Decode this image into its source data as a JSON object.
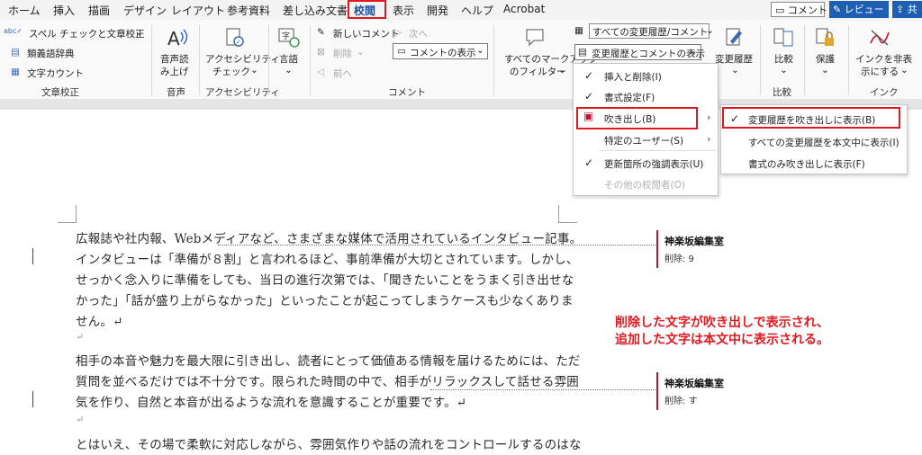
{
  "menu": {
    "tabs": [
      "ホーム",
      "挿入",
      "描画",
      "デザイン",
      "レイアウト",
      "参考資料",
      "差し込み文書",
      "校閲",
      "表示",
      "開発",
      "ヘルプ",
      "Acrobat"
    ],
    "active_tab": "校閲",
    "comment_button": "コメント",
    "review_button": "レビュー",
    "share_button": "共"
  },
  "ribbon": {
    "proofing": {
      "spell_check": "スペル チェックと文章校正",
      "thesaurus": "類義語辞典",
      "word_count": "文字カウント",
      "label": "文章校正"
    },
    "speech": {
      "read_aloud_line1": "音声読",
      "read_aloud_line2": "み上げ",
      "label": "音声"
    },
    "accessibility": {
      "check_line1": "アクセシビリティ",
      "check_line2": "チェック",
      "label": "アクセシビリティ"
    },
    "language": {
      "button": "言語"
    },
    "comments": {
      "new_comment": "新しいコメント",
      "delete": "削除",
      "prev": "前へ",
      "next": "次へ",
      "show_comments": "コメントの表示",
      "label": "コメント"
    },
    "tracking": {
      "all_markup_line1": "すべてのマークアップ",
      "all_markup_line2": "のフィルター",
      "all_changes": "すべての変更履歴/コメント",
      "show_markup": "変更履歴とコメントの表示"
    },
    "changes": {
      "track_changes": "変更履歴"
    },
    "compare": {
      "button": "比較",
      "label": "比較"
    },
    "protect": {
      "button": "保護"
    },
    "ink": {
      "hide_line1": "インクを非表",
      "hide_line2": "示にする",
      "label": "インク"
    }
  },
  "show_markup_menu": {
    "items": [
      {
        "label": "挿入と削除(I)",
        "checked": true
      },
      {
        "label": "書式設定(F)",
        "checked": true
      },
      {
        "label": "吹き出し(B)",
        "checked": false,
        "submenu": true
      },
      {
        "label": "特定のユーザー(S)",
        "checked": false,
        "submenu": true
      },
      {
        "label": "更新箇所の強調表示(U)",
        "checked": true
      },
      {
        "label": "その他の校閲者(O)",
        "checked": false,
        "disabled": true
      }
    ]
  },
  "balloons_submenu": {
    "items": [
      {
        "label": "変更履歴を吹き出しに表示(B)",
        "checked": true
      },
      {
        "label": "すべての変更履歴を本文中に表示(I)",
        "checked": false
      },
      {
        "label": "書式のみ吹き出しに表示(F)",
        "checked": false
      }
    ]
  },
  "document": {
    "lines": [
      "広報誌や社内報、Webメディアなど、さまざまな媒体で活用されているインタビュー記事。",
      "インタビューは「準備が８割」と言われるほど、事前準備が大切とされています。しかし、",
      "せっかく念入りに準備をしても、当日の進行次第では、「聞きたいことをうまく引き出せな",
      "かった」「話が盛り上がらなかった」といったことが起こってしまうケースも少なくありま",
      "せん。↵",
      "↵",
      "相手の本音や魅力を最大限に引き出し、読者にとって価値ある情報を届けるためには、ただ",
      "質問を並べるだけでは不十分です。限られた時間の中で、相手がリラックスして話せる雰囲",
      "気を作り、自然と本音が出るような流れを意識することが重要です。↵",
      "↵",
      "とはいえ、その場で柔軟に対応しながら、雰囲気作りや話の流れをコントロールするのはな"
    ]
  },
  "comments": [
    {
      "author": "神楽坂編集室",
      "text": "削除: 9"
    },
    {
      "author": "神楽坂編集室",
      "text": "削除: す"
    }
  ],
  "annotation": {
    "line1": "削除した文字が吹き出しで表示され、",
    "line2": "追加した文字は本文中に表示される。"
  },
  "colors": {
    "highlight_red": "#e0191f",
    "review_blue": "#1f5fb3",
    "deletion_red": "#c8102e"
  }
}
